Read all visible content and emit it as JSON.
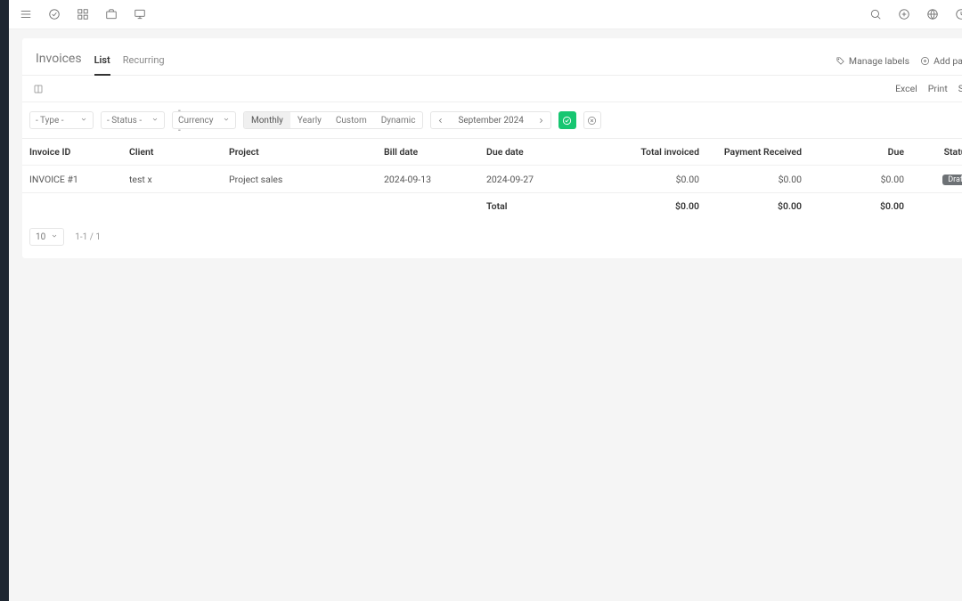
{
  "page": {
    "title": "Invoices",
    "tabs": {
      "list": "List",
      "recurring": "Recurring"
    }
  },
  "actions": {
    "manage_labels": "Manage labels",
    "add_payment": "Add pa",
    "excel": "Excel",
    "print": "Print",
    "extra": "S"
  },
  "filters": {
    "type": "- Type -",
    "status": "- Status -",
    "currency": "- Currency -",
    "periods": {
      "monthly": "Monthly",
      "yearly": "Yearly",
      "custom": "Custom",
      "dynamic": "Dynamic"
    },
    "month": "September 2024"
  },
  "table": {
    "headers": {
      "invoice_id": "Invoice ID",
      "client": "Client",
      "project": "Project",
      "bill_date": "Bill date",
      "due_date": "Due date",
      "total_invoiced": "Total invoiced",
      "payment_received": "Payment Received",
      "due": "Due",
      "status": "Status"
    },
    "rows": [
      {
        "invoice_id": "INVOICE #1",
        "client": "test x",
        "project": "Project sales",
        "bill_date": "2024-09-13",
        "due_date": "2024-09-27",
        "total_invoiced": "$0.00",
        "payment_received": "$0.00",
        "due": "$0.00",
        "status": "Draft"
      }
    ],
    "total_row": {
      "label": "Total",
      "total_invoiced": "$0.00",
      "payment_received": "$0.00",
      "due": "$0.00"
    }
  },
  "pager": {
    "page_size": "10",
    "range": "1-1 / 1"
  }
}
